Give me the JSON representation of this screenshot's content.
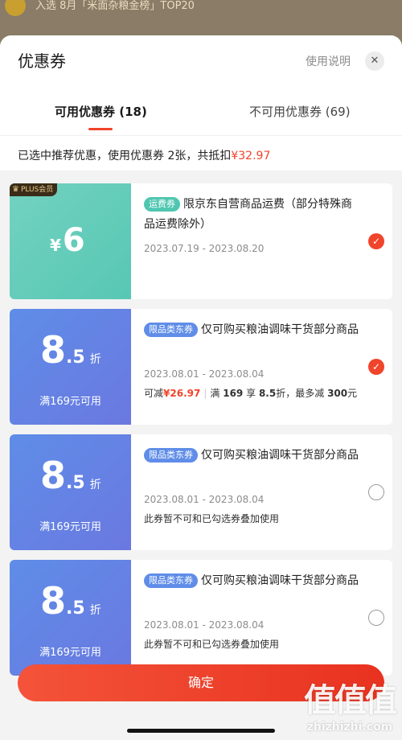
{
  "background": {
    "text": "入选 8月「米面杂粮金榜」TOP20"
  },
  "header": {
    "title": "优惠券",
    "help_label": "使用说明",
    "close_icon": "close-icon"
  },
  "tabs": [
    {
      "label": "可用优惠券 (18)",
      "active": true
    },
    {
      "label": "不可用优惠券 (69)",
      "active": false
    }
  ],
  "summary": {
    "prefix": "已选中推荐优惠，使用优惠券 2张，共抵扣",
    "amount": "¥32.97"
  },
  "coupons": [
    {
      "badge": "PLUS会员",
      "currency": "¥",
      "value": "6",
      "tag": "运费券",
      "description": "限京东自营商品运费（部分特殊商品运费除外）",
      "date": "2023.07.19 - 2023.08.20",
      "selected": true
    },
    {
      "value_int": "8",
      "value_dec": ".5",
      "unit": "折",
      "condition": "满169元可用",
      "tag": "限品类东券",
      "description": "仅可购买粮油调味干货部分商品",
      "date": "2023.08.01 - 2023.08.04",
      "extra": {
        "save_prefix": "可减",
        "save_amount": "¥26.97",
        "rule_a": "满",
        "rule_b": "169",
        "rule_c": "享",
        "rule_d": "8.5",
        "rule_e": "折，最多减",
        "rule_f": "300",
        "rule_g": "元"
      },
      "selected": true
    },
    {
      "value_int": "8",
      "value_dec": ".5",
      "unit": "折",
      "condition": "满169元可用",
      "tag": "限品类东券",
      "description": "仅可购买粮油调味干货部分商品",
      "date": "2023.08.01 - 2023.08.04",
      "note": "此券暂不可和已勾选券叠加使用",
      "selected": false
    },
    {
      "value_int": "8",
      "value_dec": ".5",
      "unit": "折",
      "condition": "满169元可用",
      "tag": "限品类东券",
      "description": "仅可购买粮油调味干货部分商品",
      "date": "2023.08.01 - 2023.08.04",
      "note": "此券暂不可和已勾选券叠加使用",
      "selected": false
    }
  ],
  "confirm_label": "确定",
  "watermark": {
    "line1": "值值值",
    "line2": "zhizhizhi.com"
  },
  "colors": {
    "accent": "#f0442b",
    "freight_coupon": "#57c7b4",
    "category_coupon": "#6a78e0"
  }
}
